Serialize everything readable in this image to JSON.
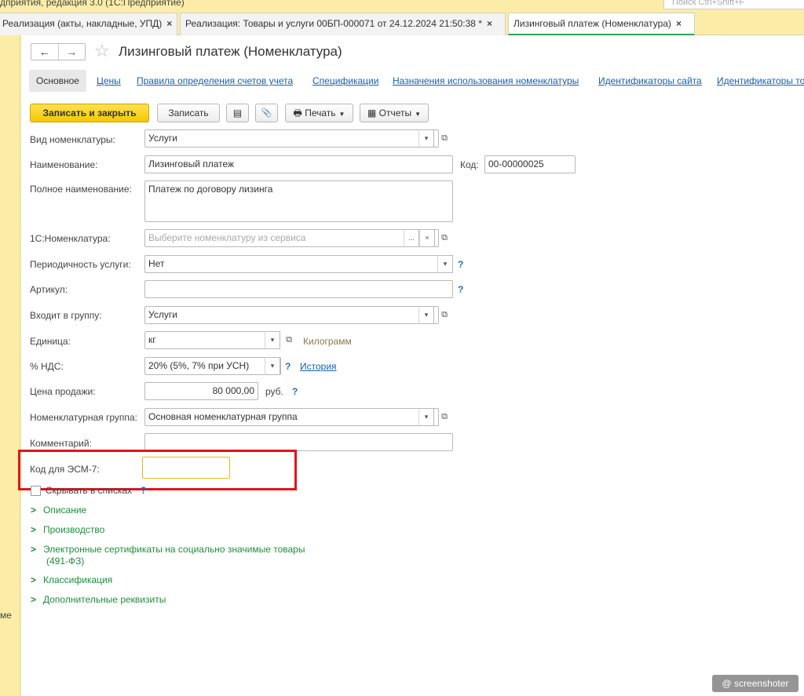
{
  "window": {
    "title_fragment": "дприятия, редакция 3.0 (1С:Предприятие)",
    "search_placeholder": "Поиск Ctrl+Shift+F"
  },
  "tabs": [
    {
      "label": "Реализация (акты, накладные, УПД)",
      "close": "×"
    },
    {
      "label": "Реализация: Товары и услуги 00БП-000071 от 24.12.2024 21:50:38 *",
      "close": "×"
    },
    {
      "label": "Лизинговый платеж (Номенклатура)",
      "close": "×"
    }
  ],
  "left_strip_text": "ме",
  "header": {
    "back": "←",
    "forward": "→",
    "star": "☆",
    "title": "Лизинговый платеж (Номенклатура)"
  },
  "nav_links": [
    "Основное",
    "Цены",
    "Правила определения счетов учета",
    "Спецификации",
    "Назначения использования номенклатуры",
    "Идентификаторы сайта",
    "Идентификаторы то"
  ],
  "toolbar": {
    "save_close": "Записать и закрыть",
    "save": "Записать",
    "list_icon": "▤",
    "attach_icon": "📎",
    "print": "Печать",
    "reports": "Отчеты",
    "dropdown": "▼"
  },
  "form": {
    "vid_label": "Вид номенклатуры:",
    "vid_value": "Услуги",
    "name_label": "Наименование:",
    "name_value": "Лизинговый платеж",
    "code_label": "Код:",
    "code_value": "00-00000025",
    "full_name_label": "Полное наименование:",
    "full_name_value": "Платеж по договору лизинга",
    "nom1c_label": "1С:Номенклатура:",
    "nom1c_placeholder": "Выберите номенклатуру из сервиса",
    "period_label": "Периодичность услуги:",
    "period_value": "Нет",
    "article_label": "Артикул:",
    "article_value": "",
    "group_label": "Входит в группу:",
    "group_value": "Услуги",
    "unit_label": "Единица:",
    "unit_value": "кг",
    "unit_hint": "Килограмм",
    "vat_label": "% НДС:",
    "vat_value": "20% (5%, 7% при УСН)",
    "vat_history": "История",
    "price_label": "Цена продажи:",
    "price_value": "80 000,00",
    "price_currency": "руб.",
    "nomgroup_label": "Номенклатурная группа:",
    "nomgroup_value": "Основная номенклатурная группа",
    "comment_label": "Комментарий:",
    "comment_value": "",
    "esm_label": "Код для ЭСМ-7:",
    "esm_value": "",
    "hide_label": "Скрывать в списках",
    "help": "?",
    "ellipsis": "...",
    "clear": "×",
    "arrow": "▾",
    "open": "⧉"
  },
  "sections": [
    "Описание",
    "Производство",
    "Электронные сертификаты на социально значимые товары",
    "(491-ФЗ)",
    "Классификация",
    "Дополнительные реквизиты"
  ],
  "watermark": "@ screenshoter"
}
